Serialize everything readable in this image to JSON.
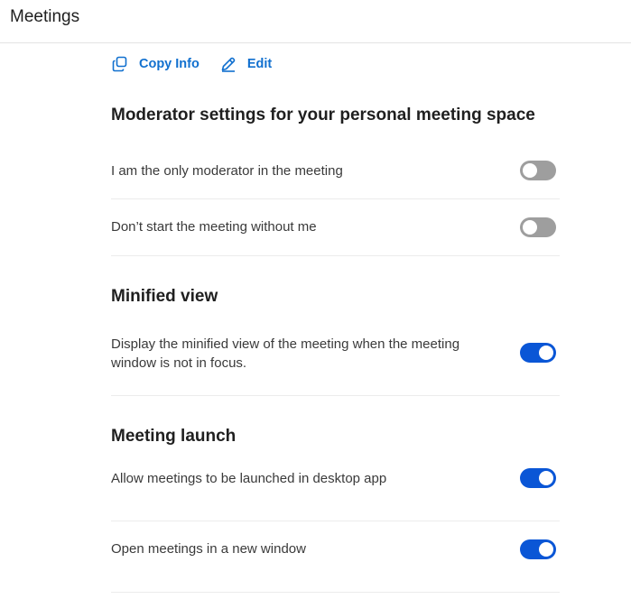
{
  "header": {
    "title": "Meetings"
  },
  "actions": {
    "copy_info": {
      "label": "Copy Info",
      "icon": "copy-icon"
    },
    "edit": {
      "label": "Edit",
      "icon": "pencil-icon"
    }
  },
  "colors": {
    "accent": "#1170cf",
    "toggle_on": "#0a56d6",
    "toggle_off": "#9e9e9e"
  },
  "sections": [
    {
      "title": "Moderator settings for your personal meeting space",
      "settings": [
        {
          "label": "I am the only moderator in the meeting",
          "enabled": false
        },
        {
          "label": "Don’t start the meeting without me",
          "enabled": false
        }
      ]
    },
    {
      "title": "Minified view",
      "settings": [
        {
          "label": "Display the minified view of the meeting when the meeting window is not in focus.",
          "enabled": true
        }
      ]
    },
    {
      "title": "Meeting launch",
      "settings": [
        {
          "label": "Allow meetings to be launched in desktop app",
          "enabled": true
        },
        {
          "label": "Open meetings in a new window",
          "enabled": true
        }
      ]
    }
  ]
}
